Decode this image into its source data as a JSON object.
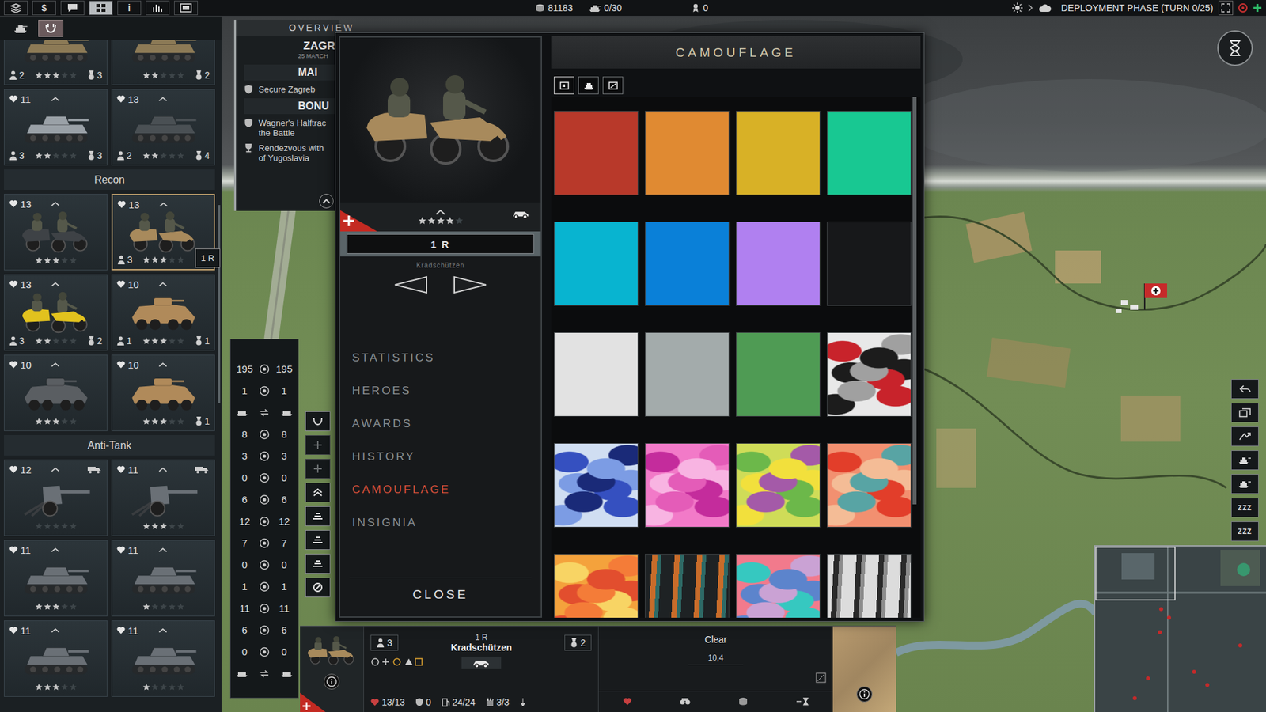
{
  "top_bar": {
    "tools": [
      {
        "glyph": "",
        "selected": false
      },
      {
        "glyph": "$",
        "selected": false
      },
      {
        "glyph": "",
        "selected": false
      },
      {
        "glyph": "",
        "selected": true
      },
      {
        "glyph": "i",
        "selected": false
      },
      {
        "glyph": "",
        "selected": false
      },
      {
        "glyph": "",
        "selected": false
      }
    ],
    "money": "81183",
    "units": "0/30",
    "heroes": "0",
    "phase": "DEPLOYMENT PHASE (TURN 0/25)"
  },
  "roster": {
    "toolbar": [
      {
        "selected": false
      },
      {
        "selected": true
      }
    ],
    "groups": [
      {
        "title": "",
        "units": [
          {
            "hp": "",
            "upgrade": false,
            "transport": false,
            "kind": "tank",
            "color": "#8c7a56",
            "left": "2",
            "stars": 3,
            "right": "3",
            "selected": false,
            "badge": ""
          },
          {
            "hp": "",
            "upgrade": false,
            "transport": false,
            "kind": "tank",
            "color": "#8c7a56",
            "left": "",
            "stars": 2,
            "right": "2",
            "selected": false,
            "badge": ""
          },
          {
            "hp": "11",
            "upgrade": true,
            "transport": false,
            "kind": "tank",
            "color": "#9aa1a7",
            "left": "3",
            "stars": 2,
            "right": "3",
            "selected": false,
            "badge": ""
          },
          {
            "hp": "13",
            "upgrade": true,
            "transport": false,
            "kind": "tank",
            "color": "#4a5054",
            "left": "2",
            "stars": 2,
            "right": "4",
            "selected": false,
            "badge": ""
          }
        ]
      },
      {
        "title": "Recon",
        "units": [
          {
            "hp": "13",
            "upgrade": true,
            "transport": false,
            "kind": "motorcycle",
            "color": "#3e4246",
            "left": "",
            "stars": 3,
            "right": "",
            "selected": false,
            "badge": ""
          },
          {
            "hp": "13",
            "upgrade": true,
            "transport": false,
            "kind": "motorcycle",
            "color": "#a88a5c",
            "left": "3",
            "stars": 3,
            "right": "",
            "selected": true,
            "badge": "1 R"
          },
          {
            "hp": "13",
            "upgrade": true,
            "transport": false,
            "kind": "motorcycle",
            "color": "#e2c21e",
            "left": "3",
            "stars": 2,
            "right": "2",
            "selected": false,
            "badge": ""
          },
          {
            "hp": "10",
            "upgrade": true,
            "transport": false,
            "kind": "armored-car",
            "color": "#b08a5a",
            "left": "1",
            "stars": 3,
            "right": "1",
            "selected": false,
            "badge": ""
          },
          {
            "hp": "10",
            "upgrade": true,
            "transport": false,
            "kind": "armored-car",
            "color": "#5a5e62",
            "left": "",
            "stars": 3,
            "right": "",
            "selected": false,
            "badge": ""
          },
          {
            "hp": "10",
            "upgrade": true,
            "transport": false,
            "kind": "armored-car",
            "color": "#b08a5a",
            "left": "",
            "stars": 3,
            "right": "1",
            "selected": false,
            "badge": ""
          }
        ]
      },
      {
        "title": "Anti-Tank",
        "units": [
          {
            "hp": "12",
            "upgrade": true,
            "transport": true,
            "kind": "gun",
            "color": "#6a7076",
            "left": "",
            "stars": 0,
            "right": "",
            "selected": false,
            "badge": ""
          },
          {
            "hp": "11",
            "upgrade": true,
            "transport": true,
            "kind": "gun",
            "color": "#6a7076",
            "left": "",
            "stars": 3,
            "right": "",
            "selected": false,
            "badge": ""
          },
          {
            "hp": "11",
            "upgrade": true,
            "transport": false,
            "kind": "tank",
            "color": "#6a7076",
            "left": "",
            "stars": 3,
            "right": "",
            "selected": false,
            "badge": ""
          },
          {
            "hp": "11",
            "upgrade": true,
            "transport": false,
            "kind": "tank",
            "color": "#6a7076",
            "left": "",
            "stars": 1,
            "right": "",
            "selected": false,
            "badge": ""
          },
          {
            "hp": "11",
            "upgrade": true,
            "transport": false,
            "kind": "tank",
            "color": "#6a7076",
            "left": "",
            "stars": 3,
            "right": "",
            "selected": false,
            "badge": ""
          },
          {
            "hp": "11",
            "upgrade": true,
            "transport": false,
            "kind": "tank",
            "color": "#6a7076",
            "left": "",
            "stars": 1,
            "right": "",
            "selected": false,
            "badge": ""
          }
        ]
      }
    ]
  },
  "overview": {
    "title": "OVERVIEW",
    "scenario": "ZAGR",
    "date": "25 MARCH",
    "main_header": "MAI",
    "main": [
      {
        "lines": [
          "Secure Zagreb"
        ]
      }
    ],
    "bonus_header": "BONU",
    "bonus": [
      {
        "lines": [
          "Wagner's Halftrac",
          "the Battle"
        ]
      },
      {
        "lines": [
          "Rendezvous with",
          "of Yugoslavia"
        ]
      }
    ]
  },
  "stats": [
    {
      "kind": "value",
      "left": "195",
      "right": "195"
    },
    {
      "kind": "value",
      "left": "1",
      "right": "1"
    },
    {
      "kind": "icons",
      "left": "",
      "right": ""
    },
    {
      "kind": "value",
      "left": "8",
      "right": "8"
    },
    {
      "kind": "value",
      "left": "3",
      "right": "3"
    },
    {
      "kind": "value",
      "left": "0",
      "right": "0"
    },
    {
      "kind": "value",
      "left": "6",
      "right": "6"
    },
    {
      "kind": "value",
      "left": "12",
      "right": "12"
    },
    {
      "kind": "value",
      "left": "7",
      "right": "7"
    },
    {
      "kind": "value",
      "left": "0",
      "right": "0"
    },
    {
      "kind": "value",
      "left": "1",
      "right": "1"
    },
    {
      "kind": "value",
      "left": "11",
      "right": "11"
    },
    {
      "kind": "value",
      "left": "6",
      "right": "6"
    },
    {
      "kind": "value",
      "left": "0",
      "right": "0"
    },
    {
      "kind": "icons",
      "left": "",
      "right": ""
    }
  ],
  "tool_column": [
    {
      "disabled": false
    },
    {
      "disabled": true
    },
    {
      "disabled": true
    },
    {
      "disabled": false
    },
    {
      "disabled": false
    },
    {
      "disabled": false
    },
    {
      "disabled": false
    },
    {
      "disabled": false
    }
  ],
  "right_tools": [
    {
      "glyph": ""
    },
    {
      "glyph": ""
    },
    {
      "glyph": ""
    },
    {
      "glyph": ""
    },
    {
      "glyph": ""
    },
    {
      "glyph": "ZZZ"
    },
    {
      "glyph": "ZZZ"
    }
  ],
  "unit_panel": {
    "upgrade": true,
    "stars": 4,
    "name": "1 R",
    "type": "Kradschützen",
    "menu": [
      {
        "label": "STATISTICS",
        "selected": false
      },
      {
        "label": "HEROES",
        "selected": false
      },
      {
        "label": "AWARDS",
        "selected": false
      },
      {
        "label": "HISTORY",
        "selected": false
      },
      {
        "label": "CAMOUFLAGE",
        "selected": true
      },
      {
        "label": "INSIGNIA",
        "selected": false
      }
    ],
    "close": "CLOSE"
  },
  "camouflage": {
    "title": "CAMOUFLAGE",
    "tabs": [
      {
        "selected": true
      },
      {
        "selected": false
      },
      {
        "selected": false
      }
    ],
    "swatches": [
      {
        "kind": "solid",
        "colors": [
          "#b8392a"
        ],
        "selected": false
      },
      {
        "kind": "solid",
        "colors": [
          "#e08a32"
        ],
        "selected": false
      },
      {
        "kind": "solid",
        "colors": [
          "#d8b126"
        ],
        "selected": false
      },
      {
        "kind": "solid",
        "colors": [
          "#18c892"
        ],
        "selected": false
      },
      {
        "kind": "solid",
        "colors": [
          "#08b4d0"
        ],
        "selected": false
      },
      {
        "kind": "solid",
        "colors": [
          "#0a80d8"
        ],
        "selected": false
      },
      {
        "kind": "solid",
        "colors": [
          "#b080f0"
        ],
        "selected": false
      },
      {
        "kind": "solid",
        "colors": [
          "#17181a"
        ],
        "selected": false
      },
      {
        "kind": "solid",
        "colors": [
          "#e2e2e2"
        ],
        "selected": false
      },
      {
        "kind": "solid",
        "colors": [
          "#a3abab"
        ],
        "selected": false
      },
      {
        "kind": "solid",
        "colors": [
          "#4f9b54"
        ],
        "selected": false
      },
      {
        "kind": "camo",
        "colors": [
          "#e8e8e8",
          "#c8232b",
          "#1c1c1c",
          "#a0a0a0"
        ],
        "selected": false
      },
      {
        "kind": "camo",
        "colors": [
          "#d0def2",
          "#3550c0",
          "#7c9ce4",
          "#1a2a78"
        ],
        "selected": false
      },
      {
        "kind": "camo",
        "colors": [
          "#f27ac8",
          "#c42c9c",
          "#f8b4e2",
          "#e45cb8"
        ],
        "selected": false
      },
      {
        "kind": "camo",
        "colors": [
          "#cfdc58",
          "#6cb84a",
          "#f2e03c",
          "#a45aa8"
        ],
        "selected": false
      },
      {
        "kind": "camo",
        "colors": [
          "#f29070",
          "#e23e2a",
          "#f4bc96",
          "#58a4a4"
        ],
        "selected": false
      },
      {
        "kind": "camo",
        "colors": [
          "#f4a23c",
          "#f8d464",
          "#e24e2e",
          "#f47c38"
        ],
        "selected": false
      },
      {
        "kind": "stripes",
        "colors": [
          "#1e2224",
          "#c86c2a",
          "#2e6a66"
        ],
        "selected": false
      },
      {
        "kind": "camo",
        "colors": [
          "#f27a8c",
          "#36c8c0",
          "#5c84cc",
          "#caa2d4"
        ],
        "selected": false
      },
      {
        "kind": "stripes",
        "colors": [
          "#dcdcdc",
          "#2a2a2a",
          "#8c8c8c"
        ],
        "selected": false
      }
    ]
  },
  "unit_bar": {
    "name": "1 R",
    "type": "Kradschützen",
    "left_count": "3",
    "right_count": "2",
    "hp": "13/13",
    "kills": "0",
    "fuel": "24/24",
    "ammo": "3/3"
  },
  "terrain_bar": {
    "terrain": "Clear",
    "coords": "10,4"
  }
}
